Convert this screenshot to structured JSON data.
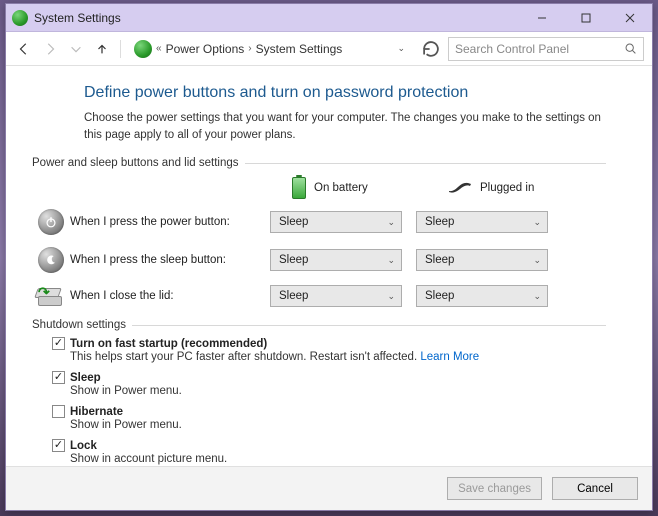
{
  "titlebar": {
    "title": "System Settings"
  },
  "nav": {
    "crumb1": "Power Options",
    "crumb2": "System Settings",
    "search_placeholder": "Search Control Panel"
  },
  "page": {
    "title": "Define power buttons and turn on password protection",
    "description": "Choose the power settings that you want for your computer. The changes you make to the settings on this page apply to all of your power plans."
  },
  "group1_label": "Power and sleep buttons and lid settings",
  "col_battery": "On battery",
  "col_plugged": "Plugged in",
  "rows": {
    "power": {
      "label": "When I press the power button:",
      "battery": "Sleep",
      "plugged": "Sleep"
    },
    "sleep": {
      "label": "When I press the sleep button:",
      "battery": "Sleep",
      "plugged": "Sleep"
    },
    "lid": {
      "label": "When I close the lid:",
      "battery": "Sleep",
      "plugged": "Sleep"
    }
  },
  "group2_label": "Shutdown settings",
  "shutdown": {
    "fast": {
      "label": "Turn on fast startup (recommended)",
      "desc": "This helps start your PC faster after shutdown. Restart isn't affected. ",
      "link": "Learn More",
      "checked": true
    },
    "sleep": {
      "label": "Sleep",
      "desc": "Show in Power menu.",
      "checked": true
    },
    "hibernate": {
      "label": "Hibernate",
      "desc": "Show in Power menu.",
      "checked": false
    },
    "lock": {
      "label": "Lock",
      "desc": "Show in account picture menu.",
      "checked": true
    }
  },
  "footer": {
    "save": "Save changes",
    "cancel": "Cancel"
  }
}
